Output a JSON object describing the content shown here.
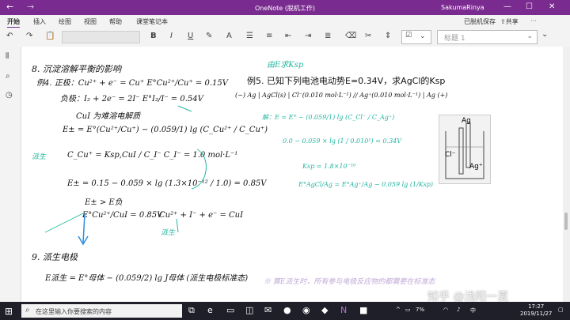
{
  "window": {
    "title": "OneNote (脱机工作)",
    "user": "SakumaRinya",
    "controls": [
      "—",
      "☐",
      "✕"
    ]
  },
  "ribbon": {
    "tabs": [
      "开始",
      "插入",
      "绘图",
      "视图",
      "帮助",
      "课堂笔记本"
    ],
    "status": "已脱机保存",
    "share": "共享"
  },
  "toolbar": {
    "bold": "B",
    "italic": "I",
    "underline": "U",
    "style_value": "标题 1"
  },
  "note": {
    "h8": "8. 沉淀溶解平衡的影响",
    "ex4": "例4. 正极：Cu²⁺ + e⁻ = Cu⁺   E°Cu²⁺/Cu⁺ = 0.15V",
    "neg": "负极：I₂ + 2e⁻ = 2I⁻   E°I₂/I⁻ = 0.54V",
    "cui": "CuI 为难溶电解质",
    "eq1": "E± = E°(Cu²⁺/Cu⁺) − (0.059/1) lg (C_Cu²⁺ / C_Cu⁺)",
    "ksp": "C_Cu⁺ = Ksp,CuI / C_I⁻    C_I⁻ = 1.0 mol·L⁻¹",
    "eq2": "E± = 0.15 − 0.059 × lg (1.3×10⁻¹² / 1.0) = 0.85V",
    "eq3": "E± > E负",
    "eq4": "E°Cu²⁺/CuI = 0.85V",
    "eq5": "Cu²⁺ + I⁻ + e⁻ = CuI",
    "derived": "派生",
    "h9": "9. 派生电极",
    "eq6": "E派生 = E°母体 − (0.059/2) lg J母体  (派生电极标准态)",
    "ex5": "例5. 已知下列电池电动势E=0.34V，求AgCl的Ksp",
    "green_head": "由E求Ksp",
    "cell": "(−) Ag | AgCl(s) | Cl⁻(0.010 mol·L⁻¹) // Ag⁺(0.010 mol·L⁻¹) | Ag (+)",
    "g1": "解：E = E° − (0.059/1) lg (C_Cl⁻ / C_Ag⁺)",
    "g2": "0.0 − 0.059 × lg (1 / 0.010²) = 0.34V",
    "g3": "Ksp = 1.8×10⁻¹⁰",
    "g4": "E°AgCl/Ag = E°Ag⁺/Ag − 0.059 lg (1/Ksp)",
    "bottom": "※ 算E派生时，所有参与电极反应物的都需要在标准态",
    "diagram_ag": "Ag",
    "diagram_cl": "Cl⁻",
    "diagram_ag2": "Ag⁺"
  },
  "taskbar": {
    "search_placeholder": "在这里输入你要搜索的内容",
    "battery": "7%",
    "time": "17:27",
    "date": "2019/11/27"
  },
  "watermark": "知乎 @浅阳一夏"
}
